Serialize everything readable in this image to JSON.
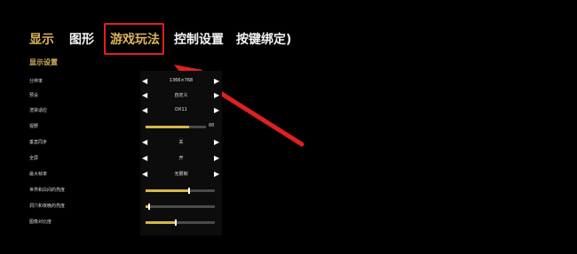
{
  "tabs": [
    {
      "label": "显示",
      "color": "#d9b45a"
    },
    {
      "label": "图形",
      "color": "#f2f2f2"
    },
    {
      "label": "游戏玩法",
      "color": "#d9b45a"
    },
    {
      "label": "控制设置",
      "color": "#f2f2f2"
    },
    {
      "label": "按键绑定)",
      "color": "#f2f2f2"
    }
  ],
  "section_title": "显示设置",
  "settings": [
    {
      "label": "分辨率",
      "type": "select",
      "value": "1366×768"
    },
    {
      "label": "预设",
      "type": "select",
      "value": "自定义"
    },
    {
      "label": "渲染适应",
      "type": "select",
      "value": "DX11"
    },
    {
      "label": "视野",
      "type": "slider",
      "value": 88,
      "fill": 0.72
    },
    {
      "label": "垂直同步",
      "type": "select",
      "value": "关"
    },
    {
      "label": "全屏",
      "type": "select",
      "value": "开"
    },
    {
      "label": "最大帧率",
      "type": "select",
      "value": "无限制"
    },
    {
      "label": "世界和白间的亮度",
      "type": "slider",
      "fill": 0.62
    },
    {
      "label": "洞穴和夜晚的亮度",
      "type": "slider",
      "fill": 0.04
    },
    {
      "label": "图像对比度",
      "type": "slider",
      "fill": 0.42
    }
  ],
  "colors": {
    "accent": "#d9b45a",
    "highlight_box": "#e02020",
    "arrow": "#e02020",
    "slider_fill": "#d6b646"
  }
}
